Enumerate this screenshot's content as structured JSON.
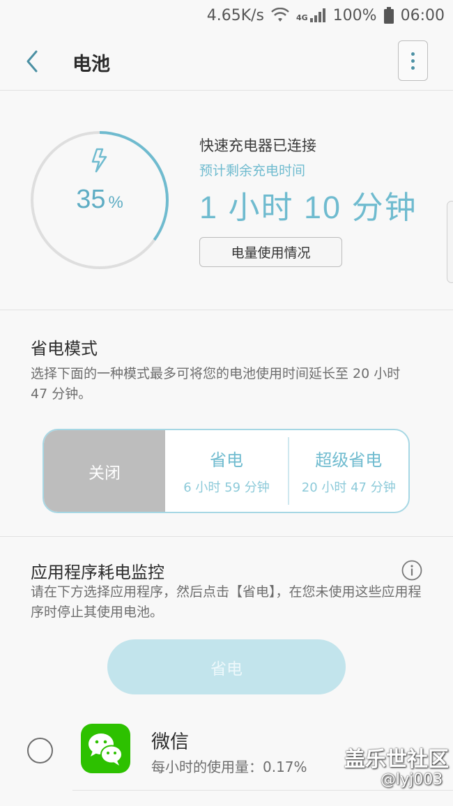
{
  "status_bar": {
    "speed": "4.65K/s",
    "network": "4G",
    "battery": "100%",
    "time": "06:00"
  },
  "header": {
    "title": "电池"
  },
  "battery": {
    "percent": "35",
    "percent_unit": "%",
    "level_fraction": 0.35,
    "charger_status": "快速充电器已连接",
    "time_label": "预计剩余充电时间",
    "time_value": "1 小时 10 分钟",
    "usage_button": "电量使用情况"
  },
  "power_saving": {
    "title": "省电模式",
    "description": "选择下面的一种模式最多可将您的电池使用时间延长至 20 小时 47 分钟。",
    "modes": [
      {
        "name": "关闭"
      },
      {
        "name": "省电",
        "time": "6 小时 59 分钟"
      },
      {
        "name": "超级省电",
        "time": "20 小时 47 分钟"
      }
    ]
  },
  "app_monitor": {
    "title": "应用程序耗电监控",
    "description": "请在下方选择应用程序，然后点击【省电】，在您未使用这些应用程序时停止其使用电池。",
    "save_button": "省电",
    "apps": [
      {
        "name": "微信",
        "usage": "每小时的使用量：0.17%"
      }
    ]
  },
  "watermark": {
    "site": "盖乐世社区",
    "user": "@lyj003"
  },
  "colors": {
    "accent": "#6fbbcf",
    "wechat_green": "#2dc100"
  }
}
